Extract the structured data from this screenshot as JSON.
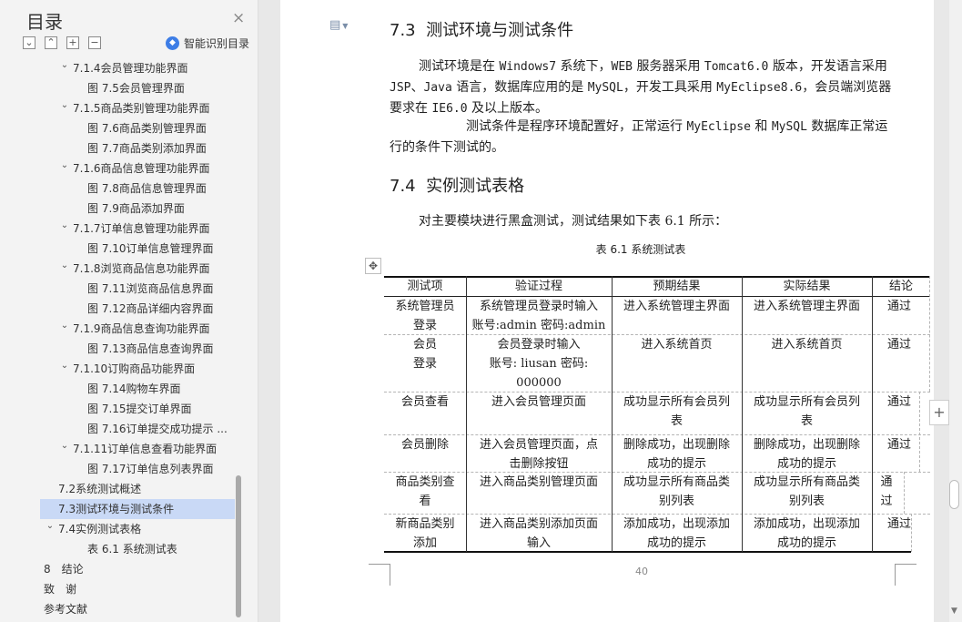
{
  "nav": {
    "title": "目录",
    "close_icon": "×",
    "toolbar": {
      "collapse": "−",
      "expand_up": "^",
      "add": "+",
      "remove": "−"
    },
    "smart_toc_label": "智能识别目录",
    "items": [
      {
        "label": "7.1.4会员管理功能界面"
      },
      {
        "label": "图 7.5会员管理界面"
      },
      {
        "label": "7.1.5商品类别管理功能界面"
      },
      {
        "label": "图 7.6商品类别管理界面"
      },
      {
        "label": "图 7.7商品类别添加界面"
      },
      {
        "label": "7.1.6商品信息管理功能界面"
      },
      {
        "label": "图 7.8商品信息管理界面"
      },
      {
        "label": "图 7.9商品添加界面"
      },
      {
        "label": "7.1.7订单信息管理功能界面"
      },
      {
        "label": "图 7.10订单信息管理界面"
      },
      {
        "label": "7.1.8浏览商品信息功能界面"
      },
      {
        "label": "图 7.11浏览商品信息界面"
      },
      {
        "label": "图 7.12商品详细内容界面"
      },
      {
        "label": "7.1.9商品信息查询功能界面"
      },
      {
        "label": "图 7.13商品信息查询界面"
      },
      {
        "label": "7.1.10订购商品功能界面"
      },
      {
        "label": "图 7.14购物车界面"
      },
      {
        "label": "图 7.15提交订单界面"
      },
      {
        "label": "图 7.16订单提交成功提示 ..."
      },
      {
        "label": "7.1.11订单信息查看功能界面"
      },
      {
        "label": "图 7.17订单信息列表界面"
      },
      {
        "label": "7.2系统测试概述"
      },
      {
        "label": "7.3测试环境与测试条件"
      },
      {
        "label": "7.4实例测试表格"
      },
      {
        "label": "表 6.1 系统测试表"
      },
      {
        "label": "8　结论"
      },
      {
        "label": "致　谢"
      },
      {
        "label": "参考文献"
      }
    ],
    "active_item": "7.3测试环境与测试条件"
  },
  "doc": {
    "section_73": {
      "num": "7.3",
      "title": "测试环境与测试条件"
    },
    "p1": {
      "a": "测试环境是在 ",
      "win": "Windows7",
      "b": " 系统下，",
      "web": "WEB",
      "c": " 服务器采用 ",
      "tomcat": "Tomcat6.0",
      "d": " 版本，开发语言采用 ",
      "jsp": "JSP",
      "e": "、",
      "java": "Java",
      "f": " 语言，数据库应用的是 ",
      "mysql": "MySQL",
      "g": "，开发工具采用 ",
      "myeclipse": "MyEclipse8.6",
      "h": "，会员端浏览器要求在 ",
      "ie": "IE6.0",
      "i": " 及以上版本。"
    },
    "p2": {
      "a": "测试条件是程序环境配置好，正常运行 ",
      "myeclipse": "MyEclipse",
      "b": " 和 ",
      "mysql": "MySQL",
      "c": " 数据库正常运行的条件下测试的。"
    },
    "section_74": {
      "num": "7.4",
      "title": "实例测试表格"
    },
    "p3": "对主要模块进行黑盒测试，测试结果如下表 6.1 所示：",
    "caption": "表 6.1 系统测试表",
    "page_number": "40"
  },
  "table": {
    "headers": [
      "测试项",
      "验证过程",
      "预期结果",
      "实际结果",
      "结论"
    ],
    "rows": [
      {
        "item": [
          "系统管理员",
          "登录"
        ],
        "process": [
          "系统管理员登录时输入",
          "账号:admin 密码:admin"
        ],
        "expected": [
          "进入系统管理主界面"
        ],
        "actual": [
          "进入系统管理主界面"
        ],
        "result": "通过"
      },
      {
        "item": [
          "会员",
          "登录"
        ],
        "process": [
          "会员登录时输入",
          "账号: liusan 密码:",
          "000000"
        ],
        "expected": [
          "进入系统首页"
        ],
        "actual": [
          "进入系统首页"
        ],
        "result": "通过"
      },
      {
        "item": [
          "会员查看"
        ],
        "process": [
          "进入会员管理页面"
        ],
        "expected": [
          "成功显示所有会员列",
          "表"
        ],
        "actual": [
          "成功显示所有会员列",
          "表"
        ],
        "result": "通过"
      },
      {
        "item": [
          "会员删除"
        ],
        "process": [
          "进入会员管理页面，点",
          "击删除按钮"
        ],
        "expected": [
          "删除成功，出现删除",
          "成功的提示"
        ],
        "actual": [
          "删除成功，出现删除",
          "成功的提示"
        ],
        "result": "通过"
      },
      {
        "item": [
          "商品类别查",
          "看"
        ],
        "process": [
          "进入商品类别管理页面"
        ],
        "expected": [
          "成功显示所有商品类",
          "别列表"
        ],
        "actual": [
          "成功显示所有商品类",
          "别列表"
        ],
        "result": "通",
        "result2": "过"
      },
      {
        "item": [
          "新商品类别",
          "添加"
        ],
        "process": [
          "进入商品类别添加页面",
          "输入"
        ],
        "expected": [
          "添加成功，出现添加",
          "成功的提示"
        ],
        "actual": [
          "添加成功，出现添加",
          "成功的提示"
        ],
        "result": "通过"
      }
    ]
  },
  "colors": {
    "active_toc": "#c9d9f6",
    "accent": "#3d7de6",
    "page": "#ffffff",
    "canvas": "#e8e8e8"
  }
}
